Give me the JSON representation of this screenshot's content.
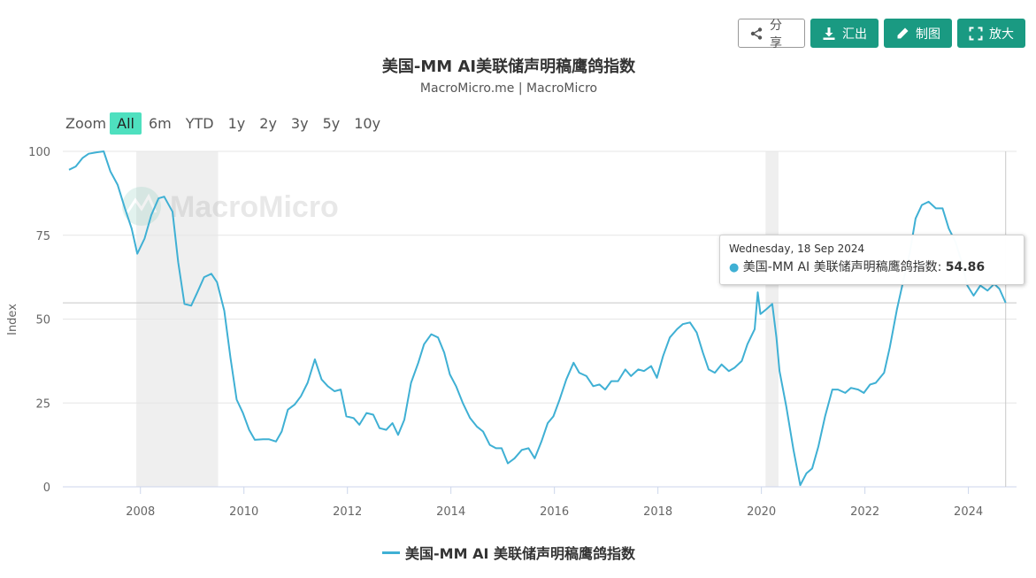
{
  "toolbar": {
    "share_label": "分享",
    "export_label": "汇出",
    "draw_label": "制图",
    "expand_label": "放大"
  },
  "title": "美国-MM AI美联储声明稿鹰鸽指数",
  "subtitle": "MacroMicro.me | MacroMicro",
  "zoom": {
    "label": "Zoom",
    "options": [
      "All",
      "6m",
      "YTD",
      "1y",
      "2y",
      "3y",
      "5y",
      "10y"
    ],
    "active": "All"
  },
  "watermark": "MacroMicro",
  "tooltip": {
    "date": "Wednesday, 18 Sep 2024",
    "series_label": "美国-MM AI 美联储声明稿鹰鸽指数:",
    "value": "54.86"
  },
  "colors": {
    "series": "#3fb0d4",
    "accent": "#1a9a82",
    "zoom_active": "#4ee0bf",
    "recession_band": "#efefef"
  },
  "icons": {
    "share": "share-icon",
    "export": "download-icon",
    "draw": "pencil-icon",
    "expand": "expand-icon"
  },
  "chart_data": {
    "type": "line",
    "title": "美国-MM AI美联储声明稿鹰鸽指数",
    "subtitle": "MacroMicro.me | MacroMicro",
    "ylabel": "Index",
    "xlabel": "",
    "ylim": [
      0,
      100
    ],
    "yticks": [
      0,
      25,
      50,
      75,
      100
    ],
    "xlim": [
      2006.5,
      2024.9
    ],
    "xticks": [
      2008,
      2010,
      2012,
      2014,
      2016,
      2018,
      2020,
      2022,
      2024
    ],
    "grid": true,
    "legend_position": "bottom-center",
    "shaded_periods": [
      [
        2007.92,
        2009.5
      ],
      [
        2020.08,
        2020.33
      ]
    ],
    "crosshair_x": 2024.72,
    "series": [
      {
        "name": "美国-MM AI 美联储声明稿鹰鸽指数",
        "color": "#3fb0d4",
        "points": [
          [
            2006.62,
            94.5
          ],
          [
            2006.75,
            95.5
          ],
          [
            2006.88,
            98
          ],
          [
            2007.0,
            99.3
          ],
          [
            2007.15,
            99.7
          ],
          [
            2007.29,
            100
          ],
          [
            2007.42,
            94
          ],
          [
            2007.56,
            90
          ],
          [
            2007.7,
            83
          ],
          [
            2007.83,
            77
          ],
          [
            2007.94,
            69.5
          ],
          [
            2008.08,
            74
          ],
          [
            2008.21,
            81
          ],
          [
            2008.35,
            86
          ],
          [
            2008.46,
            86.5
          ],
          [
            2008.62,
            82
          ],
          [
            2008.73,
            67
          ],
          [
            2008.85,
            54.5
          ],
          [
            2008.98,
            54
          ],
          [
            2009.1,
            58
          ],
          [
            2009.23,
            62.5
          ],
          [
            2009.37,
            63.5
          ],
          [
            2009.48,
            61
          ],
          [
            2009.62,
            52.5
          ],
          [
            2009.74,
            38.5
          ],
          [
            2009.86,
            26
          ],
          [
            2009.98,
            22
          ],
          [
            2010.1,
            17
          ],
          [
            2010.21,
            14
          ],
          [
            2010.37,
            14.2
          ],
          [
            2010.48,
            14.2
          ],
          [
            2010.62,
            13.5
          ],
          [
            2010.73,
            16.5
          ],
          [
            2010.85,
            23
          ],
          [
            2010.98,
            24.5
          ],
          [
            2011.1,
            27
          ],
          [
            2011.23,
            31
          ],
          [
            2011.37,
            38
          ],
          [
            2011.5,
            32
          ],
          [
            2011.62,
            30
          ],
          [
            2011.75,
            28.5
          ],
          [
            2011.87,
            29
          ],
          [
            2011.98,
            21
          ],
          [
            2012.12,
            20.5
          ],
          [
            2012.23,
            18.5
          ],
          [
            2012.37,
            22
          ],
          [
            2012.5,
            21.5
          ],
          [
            2012.62,
            17.5
          ],
          [
            2012.75,
            17
          ],
          [
            2012.87,
            19
          ],
          [
            2012.98,
            15.5
          ],
          [
            2013.1,
            20
          ],
          [
            2013.23,
            31
          ],
          [
            2013.37,
            37
          ],
          [
            2013.48,
            42.5
          ],
          [
            2013.62,
            45.5
          ],
          [
            2013.75,
            44.5
          ],
          [
            2013.87,
            40
          ],
          [
            2013.98,
            33.5
          ],
          [
            2014.1,
            30
          ],
          [
            2014.23,
            25
          ],
          [
            2014.37,
            20.5
          ],
          [
            2014.5,
            18
          ],
          [
            2014.62,
            16.5
          ],
          [
            2014.75,
            12.5
          ],
          [
            2014.87,
            11.5
          ],
          [
            2014.98,
            11.5
          ],
          [
            2015.1,
            7
          ],
          [
            2015.23,
            8.5
          ],
          [
            2015.37,
            11
          ],
          [
            2015.5,
            11.5
          ],
          [
            2015.62,
            8.5
          ],
          [
            2015.75,
            13.5
          ],
          [
            2015.87,
            19
          ],
          [
            2015.98,
            21
          ],
          [
            2016.1,
            26
          ],
          [
            2016.23,
            32
          ],
          [
            2016.37,
            37
          ],
          [
            2016.48,
            34
          ],
          [
            2016.62,
            33
          ],
          [
            2016.75,
            30
          ],
          [
            2016.87,
            30.5
          ],
          [
            2016.98,
            29
          ],
          [
            2017.1,
            31.5
          ],
          [
            2017.23,
            31.5
          ],
          [
            2017.37,
            35
          ],
          [
            2017.48,
            33
          ],
          [
            2017.62,
            35
          ],
          [
            2017.73,
            34.5
          ],
          [
            2017.87,
            36
          ],
          [
            2017.98,
            32.5
          ],
          [
            2018.1,
            39
          ],
          [
            2018.23,
            44.5
          ],
          [
            2018.37,
            47
          ],
          [
            2018.48,
            48.5
          ],
          [
            2018.62,
            49
          ],
          [
            2018.75,
            46
          ],
          [
            2018.87,
            40
          ],
          [
            2018.98,
            35
          ],
          [
            2019.1,
            34
          ],
          [
            2019.23,
            36.5
          ],
          [
            2019.37,
            34.5
          ],
          [
            2019.48,
            35.5
          ],
          [
            2019.62,
            37.5
          ],
          [
            2019.73,
            42.5
          ],
          [
            2019.87,
            47
          ],
          [
            2019.93,
            58
          ],
          [
            2019.98,
            51.5
          ],
          [
            2020.1,
            53
          ],
          [
            2020.21,
            54.5
          ],
          [
            2020.29,
            44.5
          ],
          [
            2020.35,
            34.5
          ],
          [
            2020.48,
            24
          ],
          [
            2020.62,
            11
          ],
          [
            2020.75,
            0.5
          ],
          [
            2020.87,
            4
          ],
          [
            2020.98,
            5.5
          ],
          [
            2021.1,
            12
          ],
          [
            2021.23,
            21
          ],
          [
            2021.37,
            29
          ],
          [
            2021.48,
            29
          ],
          [
            2021.62,
            28
          ],
          [
            2021.73,
            29.5
          ],
          [
            2021.87,
            29
          ],
          [
            2021.98,
            28
          ],
          [
            2022.1,
            30.5
          ],
          [
            2022.21,
            31
          ],
          [
            2022.37,
            34
          ],
          [
            2022.48,
            41.5
          ],
          [
            2022.62,
            53
          ],
          [
            2022.75,
            62
          ],
          [
            2022.87,
            70
          ],
          [
            2022.98,
            80
          ],
          [
            2023.1,
            84
          ],
          [
            2023.23,
            85
          ],
          [
            2023.37,
            83
          ],
          [
            2023.5,
            83
          ],
          [
            2023.62,
            77
          ],
          [
            2023.75,
            73
          ],
          [
            2023.87,
            67
          ],
          [
            2023.98,
            60
          ],
          [
            2024.1,
            57
          ],
          [
            2024.23,
            60
          ],
          [
            2024.37,
            58.5
          ],
          [
            2024.5,
            60.5
          ],
          [
            2024.6,
            59
          ],
          [
            2024.72,
            54.86
          ]
        ]
      }
    ]
  }
}
